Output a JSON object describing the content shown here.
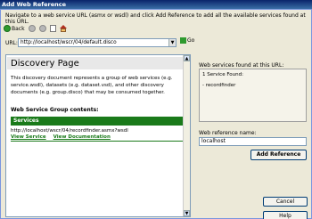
{
  "window": {
    "title": "Add Web Reference"
  },
  "instruction": "Navigate to a web service URL (asmx or wsdl) and click Add Reference to add all the available services found at this URL.",
  "toolbar": {
    "back_label": "Back"
  },
  "url": {
    "label": "URL:",
    "value": "http://localhost/wscr/04/default.disco",
    "go_label": "Go"
  },
  "browser": {
    "page_title": "Discovery Page",
    "description": "This discovery document represents a group of web services (e.g. service.wsdl), datasets (e.g. dataset.vsd), and other discovery documents (e.g. group.disco) that may be consumed together.",
    "group_title": "Web Service Group contents:",
    "services_header": "Services",
    "service_url": "http://localhost/wscr/04/recordfinder.asmx?wsdl",
    "view_service": "View Service",
    "view_documentation": "View Documentation"
  },
  "right": {
    "found_label": "Web services found at this URL:",
    "found_title": "1 Service Found:",
    "found_item": "- recordfinder",
    "ref_name_label": "Web reference name:",
    "ref_name_value": "localhost",
    "add_reference_label": "Add Reference"
  },
  "buttons": {
    "cancel_label": "Cancel",
    "help_label": "Help"
  }
}
